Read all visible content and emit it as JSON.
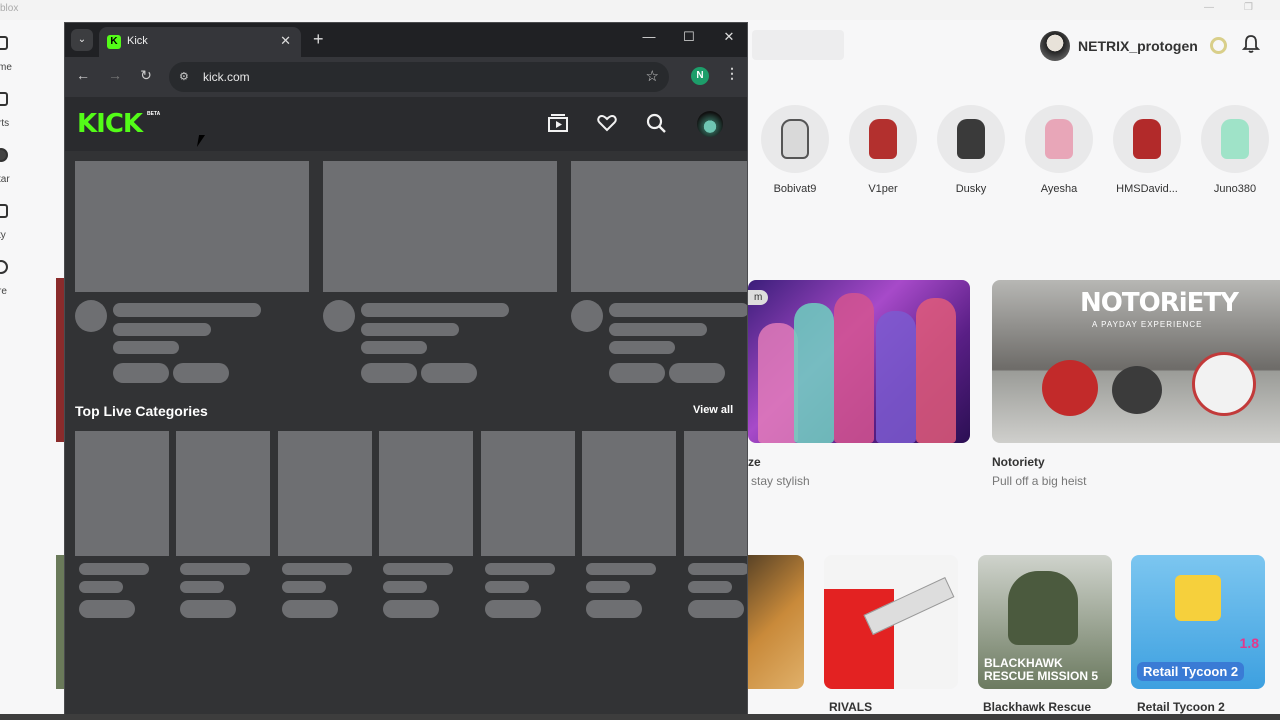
{
  "roblox": {
    "window_title": "blox",
    "sidebar": [
      {
        "label": "me"
      },
      {
        "label": "rts"
      },
      {
        "label": "tar"
      },
      {
        "label": "ty"
      },
      {
        "label": "re"
      }
    ],
    "username": "NETRIX_protogen",
    "friends": [
      {
        "name": "Bobivat9",
        "color": "#d9d9d9"
      },
      {
        "name": "V1per",
        "color": "#b3302e"
      },
      {
        "name": "Dusky",
        "color": "#3a3a3a"
      },
      {
        "name": "Ayesha",
        "color": "#e8a6b8"
      },
      {
        "name": "HMSDavid...",
        "color": "#b22a2a"
      },
      {
        "name": "Juno380",
        "color": "#9fe3c8"
      }
    ],
    "featured_games": [
      {
        "title": "ze",
        "subtitle": "stay stylish",
        "badge": "m"
      },
      {
        "title": "Notoriety",
        "subtitle": "Pull off a big heist",
        "logo": "NOTORiETY",
        "logo_sub": "A PAYDAY EXPERIENCE"
      }
    ],
    "games": [
      {
        "title": "",
        "accent": "#c98a3a"
      },
      {
        "title": "RIVALS",
        "accent": "#e32222"
      },
      {
        "title": "Blackhawk Rescue",
        "overlay": "BLACKHAWK RESCUE MISSION 5",
        "accent": "#4b5a3e"
      },
      {
        "title": "Retail Tycoon 2",
        "overlay": "Retail Tycoon 2",
        "badge": "1.8",
        "accent": "#3da0e0"
      }
    ]
  },
  "browser": {
    "tab_title": "Kick",
    "favicon": "K",
    "url": "kick.com",
    "profile_initial": "N",
    "kick": {
      "logo": "KICK",
      "beta": "BETA",
      "accent": "#53fc18",
      "section_title": "Top Live Categories",
      "view_all": "View all"
    }
  }
}
